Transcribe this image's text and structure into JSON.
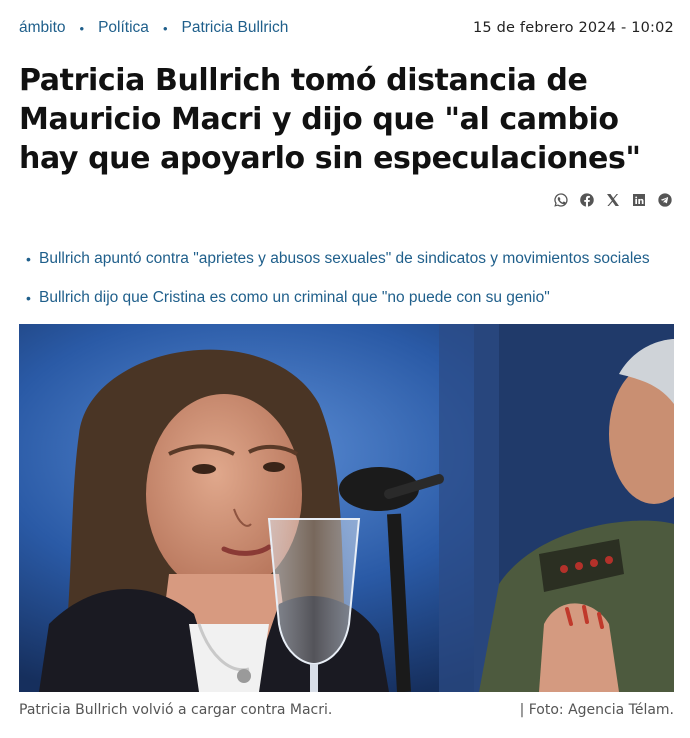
{
  "breadcrumb": {
    "items": [
      "ámbito",
      "Política",
      "Patricia Bullrich"
    ],
    "separator": "•"
  },
  "date": "15 de febrero 2024 - 10:02",
  "headline": "Patricia Bullrich tomó distancia de Mauricio Macri y dijo que \"al cambio hay que apoyarlo sin especulaciones\"",
  "share": [
    "whatsapp-icon",
    "facebook-icon",
    "x-icon",
    "linkedin-icon",
    "telegram-icon"
  ],
  "related": [
    "Bullrich apuntó contra \"aprietes y abusos sexuales\" de sindicatos y movimientos sociales",
    "Bullrich dijo que Cristina es como un criminal que \"no puede con su genio\""
  ],
  "photo": {
    "caption": "Patricia Bullrich volvió a cargar contra Macri.",
    "credit": "| Foto: Agencia Télam."
  },
  "colors": {
    "link": "#1f5f8b",
    "text": "#111111",
    "muted": "#555555"
  }
}
